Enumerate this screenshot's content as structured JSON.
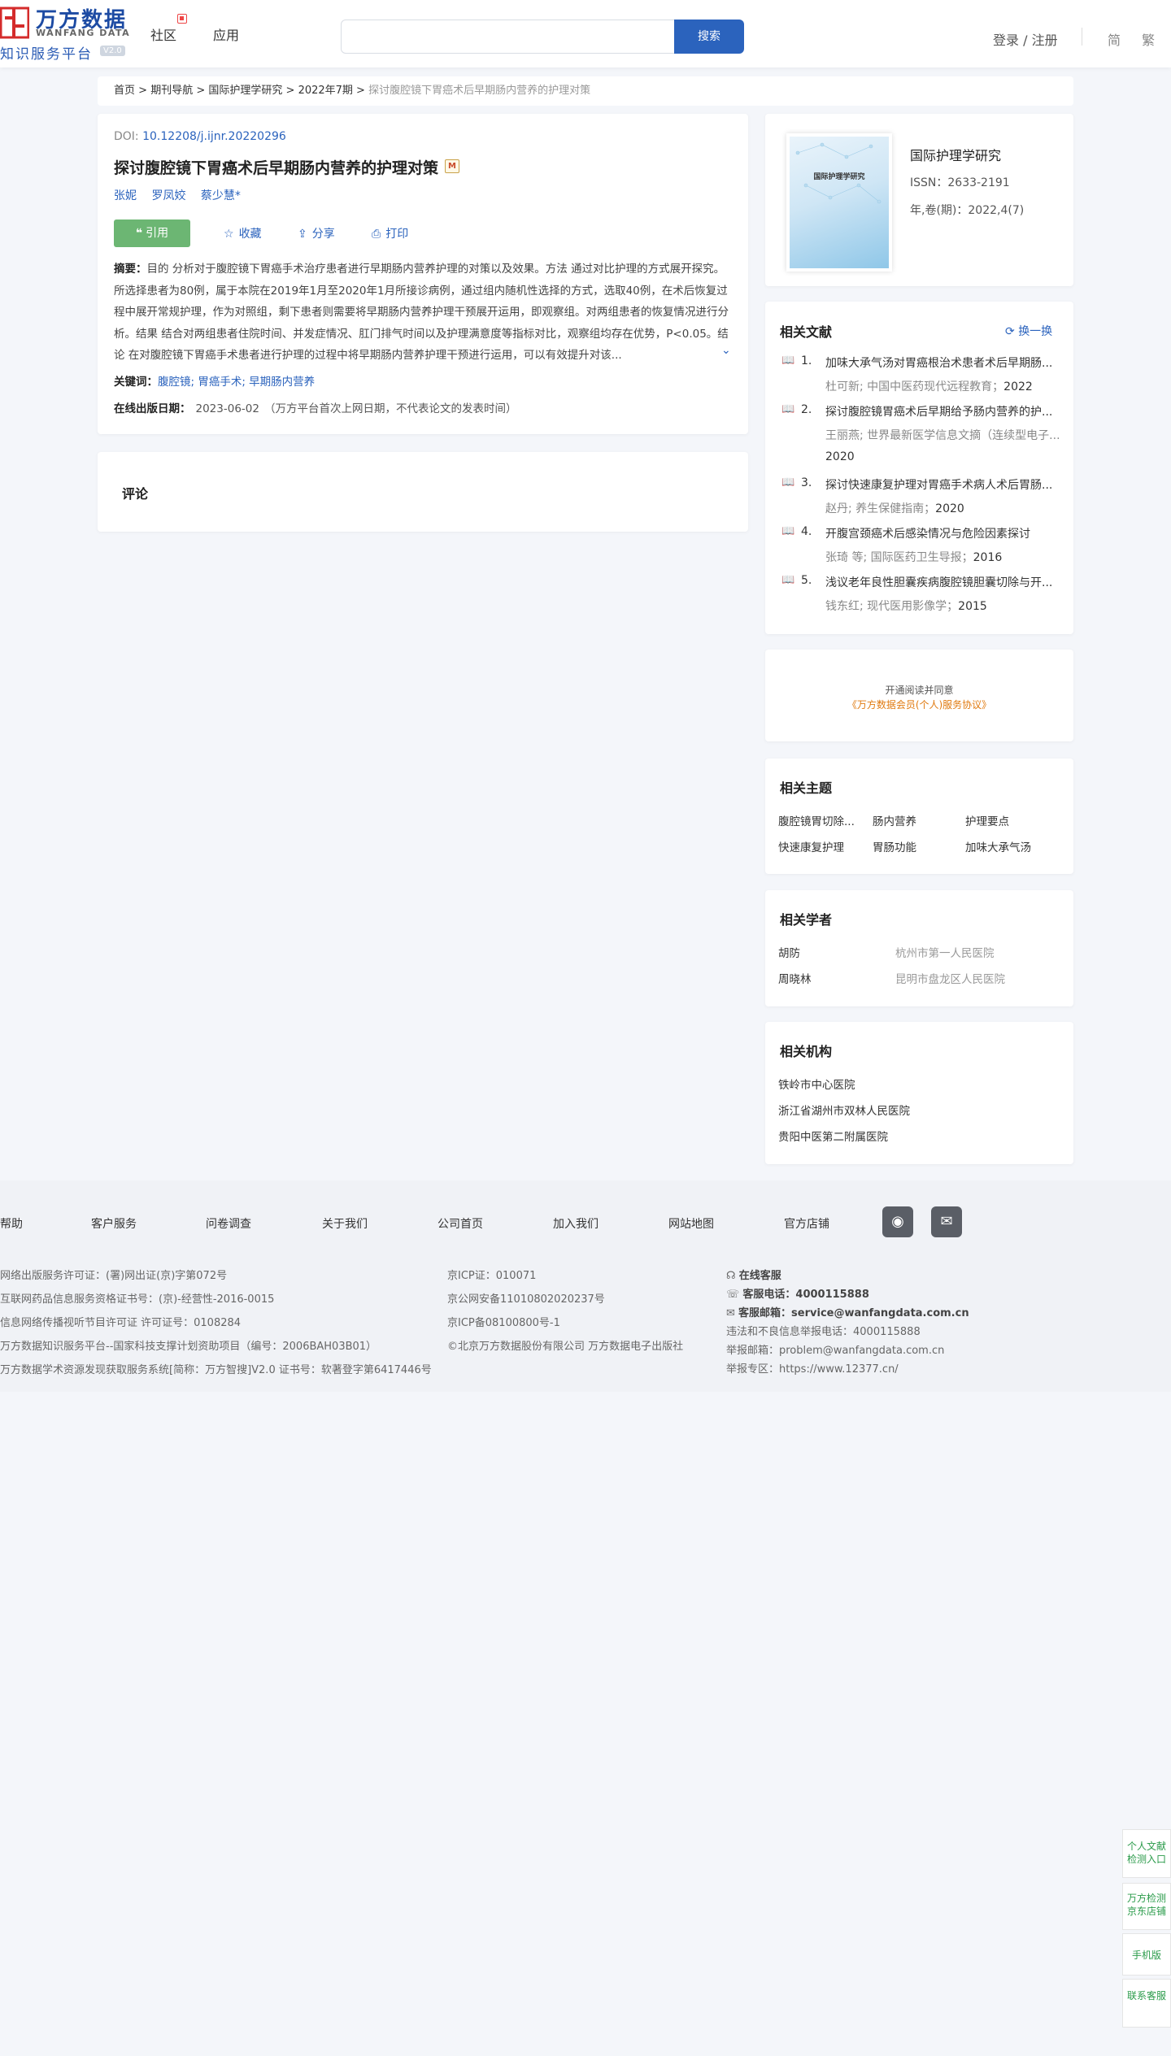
{
  "header": {
    "logo_cn": "万方数据",
    "logo_en": "WANFANG DATA",
    "logo_sub": "知识服务平台",
    "version": "V2.0",
    "nav": [
      "社区",
      "应用"
    ],
    "search_placeholder": "",
    "search_button": "搜索",
    "login": "登录 / 注册",
    "lang_simplified": "简",
    "lang_traditional": "繁"
  },
  "breadcrumb": {
    "items": [
      "首页",
      "期刊导航",
      "国际护理学研究",
      "2022年7期"
    ],
    "sep": " > ",
    "current": "探讨腹腔镜下胃癌术后早期肠内营养的护理对策"
  },
  "article": {
    "doi_label": "DOI: ",
    "doi": "10.12208/j.ijnr.20220296",
    "title": "探讨腹腔镜下胃癌术后早期肠内营养的护理对策",
    "title_badge": "M",
    "authors": [
      "张妮",
      "罗凤姣",
      "蔡少慧*"
    ],
    "actions": {
      "cite": "引用",
      "favorite": "收藏",
      "share": "分享",
      "print": "打印"
    },
    "abstract_label": "摘要：",
    "abstract": "目的 分析对于腹腔镜下胃癌手术治疗患者进行早期肠内营养护理的对策以及效果。方法 通过对比护理的方式展开探究。所选择患者为80例，属于本院在2019年1月至2020年1月所接诊病例，通过组内随机性选择的方式，选取40例，在术后恢复过程中展开常规护理，作为对照组，剩下患者则需要将早期肠内营养护理干预展开运用，即观察组。对两组患者的恢复情况进行分析。结果 结合对两组患者住院时间、并发症情况、肛门排气时间以及护理满意度等指标对比，观察组均存在优势，P<0.05。结论 在对腹腔镜下胃癌手术患者进行护理的过程中将早期肠内营养护理干预进行运用，可以有效提升对该...",
    "keywords_label": "关键词：",
    "keywords": "腹腔镜; 胃癌手术; 早期肠内营养",
    "pubdate_label": "在线出版日期：",
    "pubdate": "2023-06-02",
    "pubdate_note": "（万方平台首次上网日期，不代表论文的发表时间）"
  },
  "comment": {
    "title": "评论"
  },
  "journal": {
    "name": "国际护理学研究",
    "cover_title": "国际护理学研究",
    "issn": "ISSN：2633-2191",
    "year": "年,卷(期)：2022,4(7)"
  },
  "related_lit": {
    "title": "相关文献",
    "swap": "换一换",
    "items": [
      {
        "num": "1.",
        "title": "加味大承气汤对胃癌根治术患者术后早期肠...",
        "source": "杜可新; 中国中医药现代远程教育；",
        "year": "2022"
      },
      {
        "num": "2.",
        "title": "探讨腹腔镜胃癌术后早期给予肠内营养的护...",
        "source": "王丽燕; 世界最新医学信息文摘（连续型电子...",
        "year": "2020"
      },
      {
        "num": "3.",
        "title": "探讨快速康复护理对胃癌手术病人术后胃肠...",
        "source": "赵丹; 养生保健指南；",
        "year": "2020"
      },
      {
        "num": "4.",
        "title": "开腹宫颈癌术后感染情况与危险因素探讨",
        "source": "张琦  等;  国际医药卫生导报；",
        "year": "2016"
      },
      {
        "num": "5.",
        "title": "浅议老年良性胆囊疾病腹腔镜胆囊切除与开...",
        "source": "钱东红; 现代医用影像学；",
        "year": "2015"
      }
    ]
  },
  "agreement": {
    "line1": "开通阅读并同意",
    "line2": "《万方数据会员(个人)服务协议》"
  },
  "topics": {
    "title": "相关主题",
    "items": [
      "腹腔镜胃切除...",
      "肠内营养",
      "护理要点",
      "快速康复护理",
      "胃肠功能",
      "加味大承气汤"
    ]
  },
  "scholars": {
    "title": "相关学者",
    "items": [
      {
        "name": "胡防",
        "org": "杭州市第一人民医院"
      },
      {
        "name": "周晓林",
        "org": "昆明市盘龙区人民医院"
      }
    ]
  },
  "orgs": {
    "title": "相关机构",
    "items": [
      "铁岭市中心医院",
      "浙江省湖州市双林人民医院",
      "贵阳中医第二附属医院"
    ]
  },
  "footer": {
    "links": [
      "帮助",
      "客户服务",
      "问卷调查",
      "关于我们",
      "公司首页",
      "加入我们",
      "网站地图",
      "官方店铺"
    ],
    "col1": [
      "网络出版服务许可证：(署)网出证(京)字第072号",
      "互联网药品信息服务资格证书号：(京)-经营性-2016-0015",
      "信息网络传播视听节目许可证 许可证号：0108284",
      "万方数据知识服务平台--国家科技支撑计划资助项目（编号：2006BAH03B01）",
      "万方数据学术资源发现获取服务系统[简称：万方智搜]V2.0 证书号：软著登字第6417446号"
    ],
    "col2": [
      "京ICP证：010071",
      "京公网安备11010802020237号",
      "京ICP备08100800号-1",
      "©北京万方数据股份有限公司 万方数据电子出版社"
    ],
    "online_service": "在线客服",
    "phone_label": "客服电话：",
    "phone": "4000115888",
    "email_label": "客服邮箱：",
    "email": "service@wanfangdata.com.cn",
    "report_phone": "违法和不良信息举报电话：4000115888",
    "report_email": "举报邮箱：problem@wanfangdata.com.cn",
    "report_site": "举报专区：https://www.12377.cn/"
  },
  "side_float": [
    "个人文献检测入口",
    "万方检测京东店铺",
    "手机版",
    "联系客服"
  ]
}
